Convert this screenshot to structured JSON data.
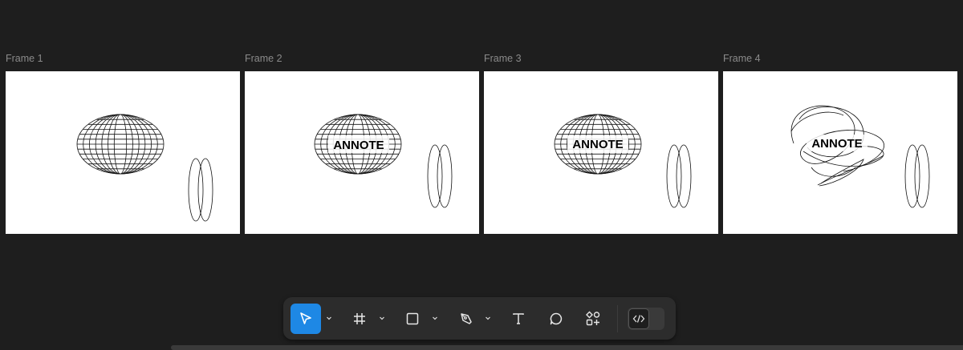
{
  "frames": [
    {
      "label": "Frame 1",
      "text": ""
    },
    {
      "label": "Frame 2",
      "text": "ANNOTE"
    },
    {
      "label": "Frame 3",
      "text": "ANNOTE"
    },
    {
      "label": "Frame 4",
      "text": "ANNOTE"
    }
  ],
  "toolbar": {
    "tools": [
      {
        "name": "move-tool",
        "icon": "cursor-arrow-icon",
        "active": true
      },
      {
        "name": "frame-tool",
        "icon": "frame-hash-icon"
      },
      {
        "name": "shape-tool",
        "icon": "rectangle-icon"
      },
      {
        "name": "pen-tool",
        "icon": "pen-nib-icon"
      },
      {
        "name": "text-tool",
        "icon": "text-t-icon"
      },
      {
        "name": "comment-tool",
        "icon": "speech-bubble-icon"
      },
      {
        "name": "actions-tool",
        "icon": "components-plus-icon"
      }
    ],
    "code_toggle_icon": "code-brackets-icon",
    "accent": "#1e88e5"
  }
}
